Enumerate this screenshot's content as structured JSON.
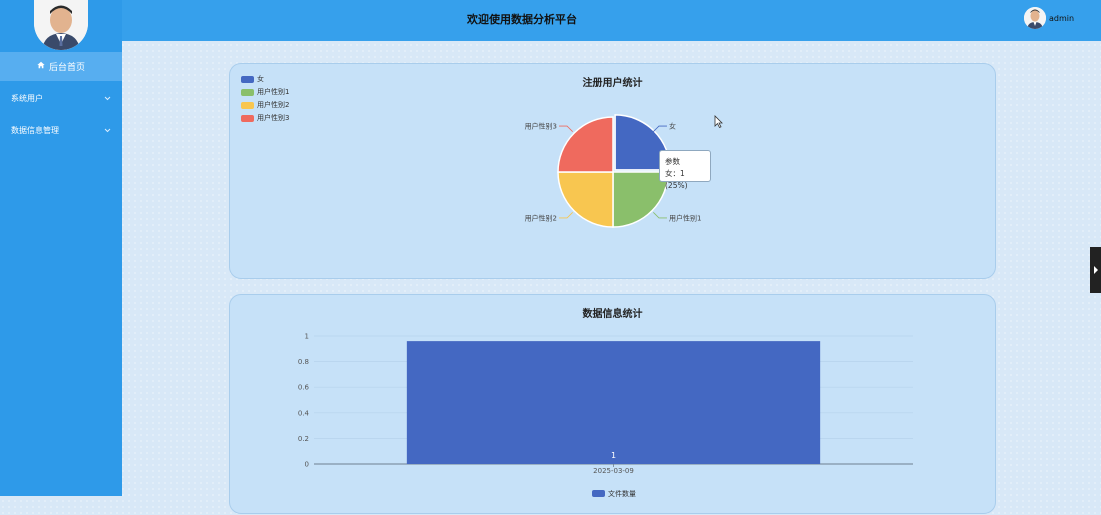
{
  "header": {
    "title": "欢迎使用数据分析平台",
    "username": "admin"
  },
  "sidebar": {
    "home_label": "后台首页",
    "items": [
      {
        "label": "系统用户"
      },
      {
        "label": "数据信息管理"
      }
    ]
  },
  "colors": {
    "sidebar": "#2e9ae9",
    "header": "#36a0ec",
    "panel": "#c6e1f8",
    "bar": "#4468c2"
  },
  "tooltip": {
    "title": "参数",
    "line": "女：1 (25%)"
  },
  "chart_data": [
    {
      "type": "pie",
      "title": "注册用户统计",
      "legend_position": "top-left",
      "categories": [
        "女",
        "用户性别1",
        "用户性别2",
        "用户性别3"
      ],
      "values": [
        1,
        1,
        1,
        1
      ],
      "colors": [
        "#4468c2",
        "#8abf6b",
        "#f8c650",
        "#ef6a5e"
      ]
    },
    {
      "type": "bar",
      "title": "数据信息统计",
      "categories": [
        "2025-03-09"
      ],
      "series": [
        {
          "name": "文件数量",
          "values": [
            1
          ]
        }
      ],
      "ylim": [
        0,
        1
      ],
      "yticks": [
        "0",
        "0.2",
        "0.4",
        "0.6",
        "0.8",
        "1"
      ],
      "legend_position": "bottom",
      "grid": true
    }
  ]
}
